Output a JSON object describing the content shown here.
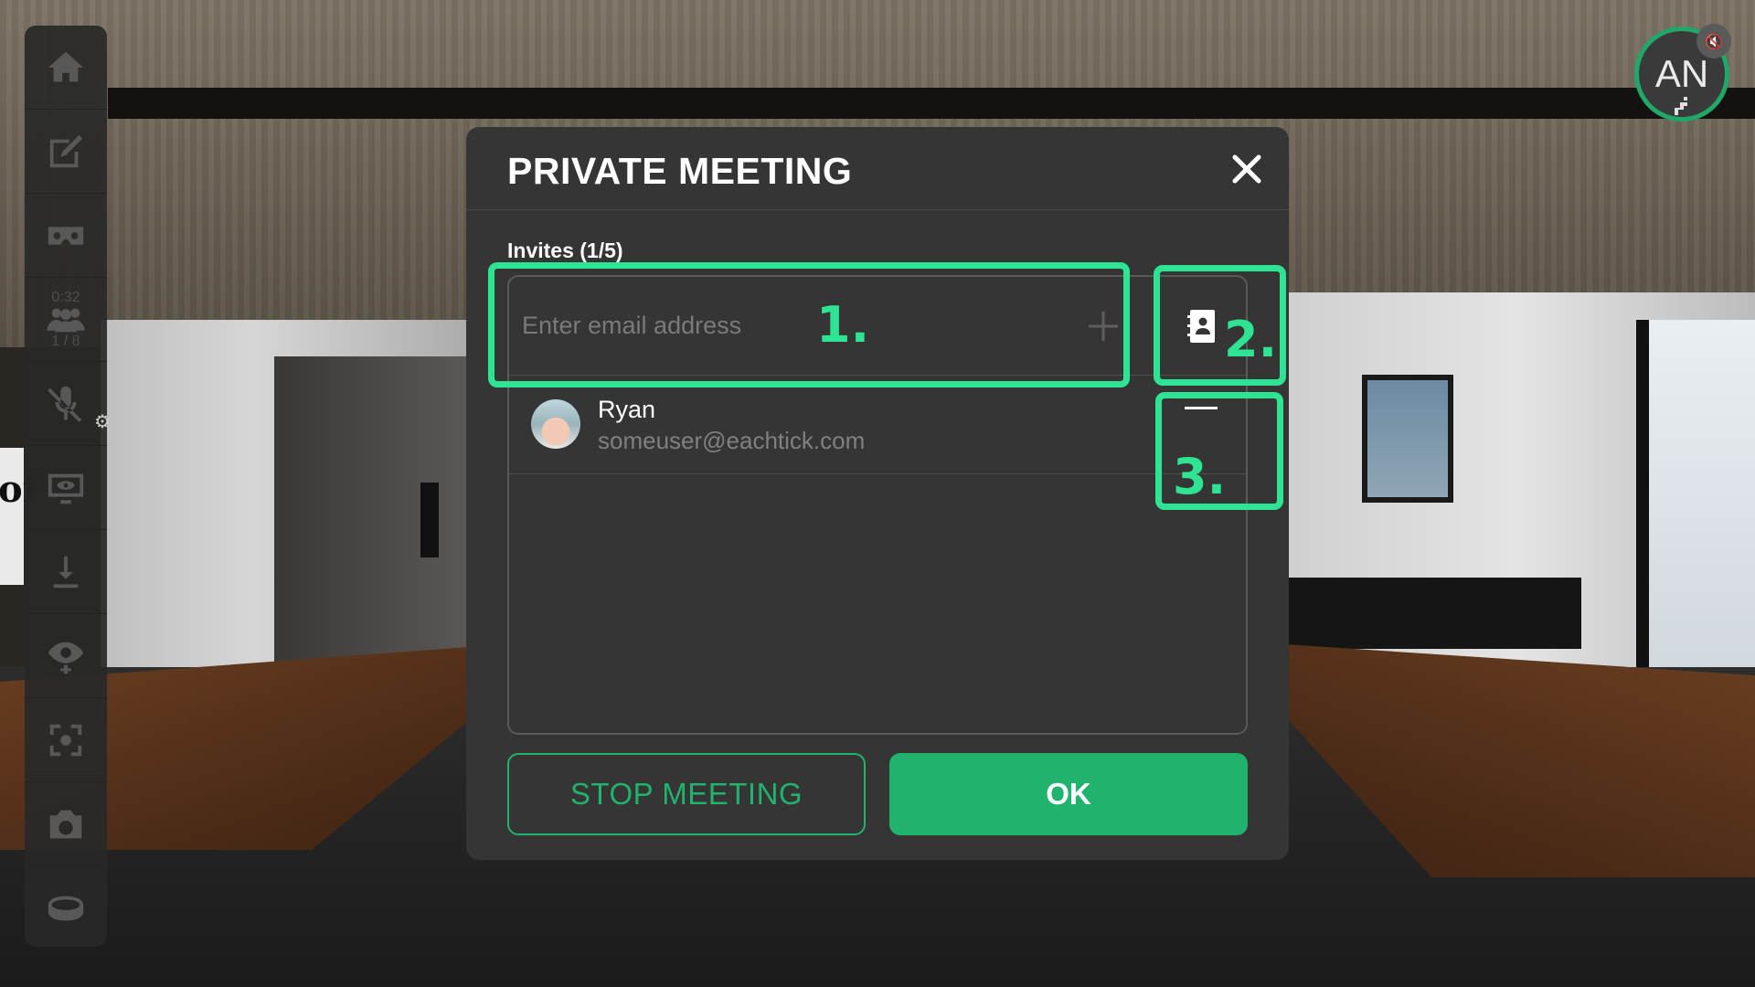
{
  "modal": {
    "title": "PRIVATE MEETING",
    "invites_label": "Invites (1/5)",
    "email_placeholder": "Enter email address",
    "invitee": {
      "name": "Ryan",
      "email": "someuser@eachtick.com"
    },
    "buttons": {
      "stop": "STOP MEETING",
      "ok": "OK"
    }
  },
  "toolbar": {
    "items": [
      "home-icon",
      "edit-icon",
      "vr-headset-icon",
      "participants-icon",
      "mic-muted-icon",
      "screen-share-icon",
      "teleport-icon",
      "view-icon",
      "focus-icon",
      "camera-icon",
      "view-360-icon"
    ],
    "timer": "0:32",
    "participant_count": "1 / 8"
  },
  "user": {
    "initials": "AN"
  },
  "annotations": [
    "1.",
    "2.",
    "3."
  ],
  "background_poster_text": "of",
  "colors": {
    "accent": "#1fb36e",
    "annotation": "#2ee391",
    "modal_bg": "#353535"
  }
}
